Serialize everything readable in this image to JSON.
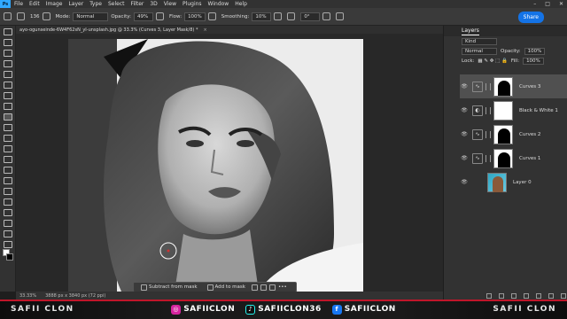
{
  "menu": {
    "logo": "Ps",
    "items": [
      "File",
      "Edit",
      "Image",
      "Layer",
      "Type",
      "Select",
      "Filter",
      "3D",
      "View",
      "Plugins",
      "Window",
      "Help"
    ],
    "window_controls": [
      "–",
      "□",
      "✕"
    ]
  },
  "options_bar": {
    "size": "136",
    "mode_label": "Mode:",
    "mode_value": "Normal",
    "opacity_label": "Opacity:",
    "opacity_value": "49%",
    "flow_label": "Flow:",
    "flow_value": "100%",
    "smoothing_label": "Smoothing:",
    "smoothing_value": "10%",
    "angle_value": "0°",
    "share_label": "Share"
  },
  "document": {
    "tab_title": "ayo-ogunseinde-6W4F62sN_yI-unsplash.jpg @ 33.3% (Curves 3, Layer Mask/8) *",
    "close": "×",
    "zoom": "33.33%",
    "dims": "3888 px x 3840 px (72 ppi)"
  },
  "contextual_taskbar": {
    "subtract_label": "Subtract from mask",
    "add_label": "Add to mask",
    "more": "•••"
  },
  "layers_panel": {
    "tab": "Layers",
    "kind_label": "Kind",
    "blend_mode": "Normal",
    "opacity_label": "Opacity:",
    "opacity_value": "100%",
    "lock_label": "Lock:",
    "fill_label": "Fill:",
    "fill_value": "100%",
    "layers": [
      {
        "name": "Curves 3",
        "active": true,
        "kind": "curves"
      },
      {
        "name": "Black & White 1",
        "active": false,
        "kind": "bw"
      },
      {
        "name": "Curves 2",
        "active": false,
        "kind": "curves"
      },
      {
        "name": "Curves 1",
        "active": false,
        "kind": "curves"
      },
      {
        "name": "Layer 0",
        "active": false,
        "kind": "pixel"
      }
    ]
  },
  "footer": {
    "brand_left": "SAFII CLON",
    "instagram": "SAFIICLON",
    "tiktok": "SAFIICLON36",
    "facebook": "SAFIICLON",
    "brand_right": "SAFII CLON",
    "colors": {
      "instagram": "#d6249f",
      "tiktok": "#111111",
      "facebook": "#1877f2",
      "accent": "#c0162a"
    }
  }
}
